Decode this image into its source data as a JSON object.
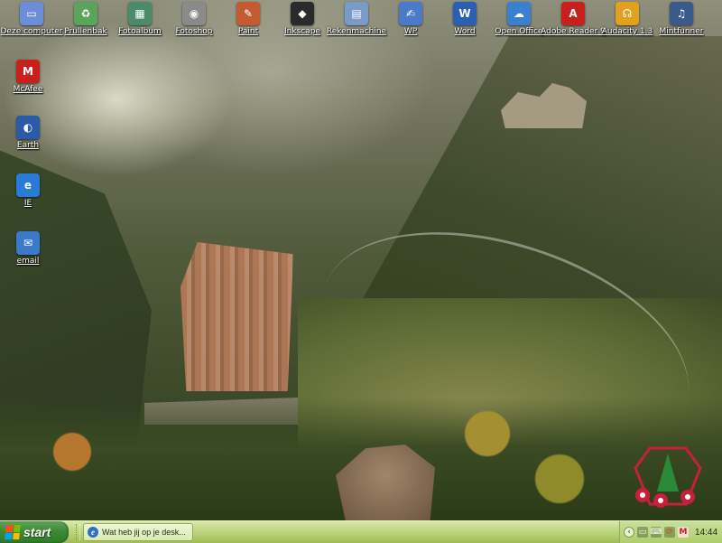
{
  "desktop": {
    "icons": [
      {
        "label": "Deze computer",
        "icon": "computer-icon",
        "color": "#6a8fd8",
        "glyph": "▭"
      },
      {
        "label": "Prullenbak",
        "icon": "recycle-bin-icon",
        "color": "#5aa55a",
        "glyph": "♻"
      },
      {
        "label": "Fotoalbum",
        "icon": "photo-album-icon",
        "color": "#4a8c6a",
        "glyph": "▦"
      },
      {
        "label": "Fotoshop",
        "icon": "camera-icon",
        "color": "#8a8a8a",
        "glyph": "◉"
      },
      {
        "label": "Paint",
        "icon": "paint-icon",
        "color": "#c45a30",
        "glyph": "✎"
      },
      {
        "label": "Inkscape",
        "icon": "inkscape-icon",
        "color": "#2a2a2a",
        "glyph": "◆"
      },
      {
        "label": "Rekenmachine",
        "icon": "calculator-icon",
        "color": "#7a9ac8",
        "glyph": "▤"
      },
      {
        "label": "WP",
        "icon": "wordpad-icon",
        "color": "#4a7ac8",
        "glyph": "✍"
      },
      {
        "label": "Word",
        "icon": "word-icon",
        "color": "#2b5fb3",
        "glyph": "W"
      },
      {
        "label": "Open Office",
        "icon": "openoffice-icon",
        "color": "#3b7fd0",
        "glyph": "☁"
      },
      {
        "label": "Adobe Reader 9",
        "icon": "adobe-reader-icon",
        "color": "#c8201c",
        "glyph": "A"
      },
      {
        "label": "Audacity 1.3",
        "icon": "audacity-icon",
        "color": "#e0a020",
        "glyph": "☊"
      },
      {
        "label": "Mintfunner",
        "icon": "mintfunner-icon",
        "color": "#3a5a8a",
        "glyph": "♫"
      }
    ],
    "left_icons": [
      {
        "label": "McAfee",
        "icon": "mcafee-icon",
        "color": "#c8201c",
        "glyph": "M"
      },
      {
        "label": "Earth",
        "icon": "earth-icon",
        "color": "#2a5aa8",
        "glyph": "◐"
      },
      {
        "label": "IE",
        "icon": "internet-explorer-icon",
        "color": "#2a7ad8",
        "glyph": "e"
      },
      {
        "label": "email",
        "icon": "email-icon",
        "color": "#3a7ac8",
        "glyph": "✉"
      }
    ]
  },
  "taskbar": {
    "start_label": "start",
    "task_label": "Wat heb jij op je desk...",
    "clock": "14:44",
    "tray_icons": [
      {
        "icon": "tray-network-icon",
        "glyph": "▭",
        "color": "#ffffff"
      },
      {
        "icon": "tray-keyboard-icon",
        "glyph": "⌨",
        "color": "#ffffff"
      },
      {
        "icon": "tray-update-icon",
        "glyph": "⟳",
        "color": "#c86020"
      },
      {
        "icon": "tray-security-icon",
        "glyph": "M",
        "color": "#c8201c"
      }
    ]
  },
  "colors": {
    "taskbar": "#b2cc6c",
    "start_button": "#3d8a36"
  }
}
